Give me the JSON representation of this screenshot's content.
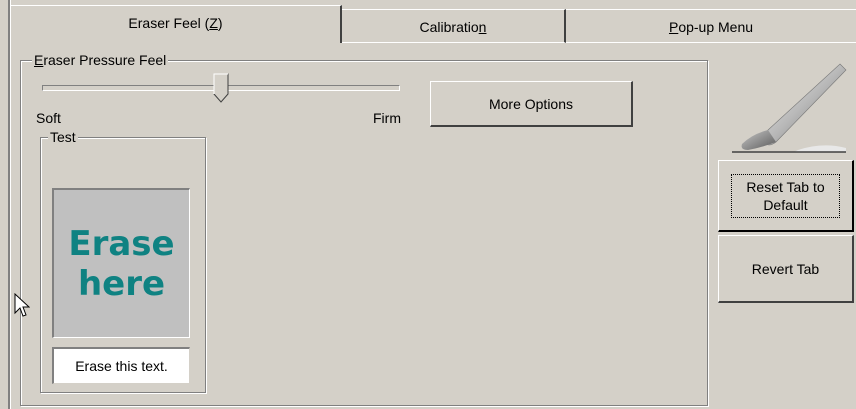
{
  "tabs": [
    {
      "label_pre": "Eraser Feel (",
      "label_key": "Z",
      "label_post": ")"
    },
    {
      "label_pre": "Calibratio",
      "label_key": "n",
      "label_post": ""
    },
    {
      "label_pre": "",
      "label_key": "P",
      "label_post": "op-up Menu"
    }
  ],
  "pressure": {
    "group_key": "E",
    "group_rest": "raser Pressure Feel",
    "soft_label": "Soft",
    "firm_label": "Firm",
    "level": 0.5
  },
  "more_options_label": "More Options",
  "test": {
    "group_label": "Test",
    "erase_line1": "Erase",
    "erase_line2": "here",
    "erase_text": "Erase this text."
  },
  "side_buttons": {
    "reset_line1": "Reset Tab to",
    "reset_line2": "Default",
    "revert_label": "Revert Tab"
  },
  "icons": [
    "pen-eraser-icon",
    "mouse-cursor-icon"
  ],
  "colors": {
    "dialog_bg": "#d4d0c8",
    "erase_text": "#0f8282",
    "erase_box": "#c0c0c0"
  }
}
